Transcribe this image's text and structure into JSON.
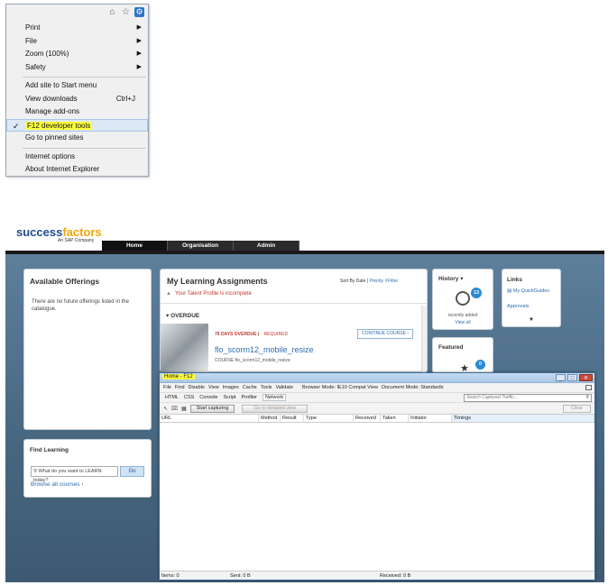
{
  "ie_menu": {
    "toolbar_icons": [
      "home-icon",
      "star-icon",
      "gear-icon"
    ],
    "items": [
      {
        "label": "Print",
        "submenu": true
      },
      {
        "label": "File",
        "submenu": true
      },
      {
        "label": "Zoom (100%)",
        "submenu": true
      },
      {
        "label": "Safety",
        "submenu": true
      },
      {
        "label": "Add site to Start menu"
      },
      {
        "label": "View downloads",
        "shortcut": "Ctrl+J"
      },
      {
        "label": "Manage add-ons"
      },
      {
        "label": "F12 developer tools",
        "selected": true
      },
      {
        "label": "Go to pinned sites"
      },
      {
        "label": "Internet options"
      },
      {
        "label": "About Internet Explorer"
      }
    ],
    "check_mark": "✓"
  },
  "sf": {
    "logo_main": "success",
    "logo_accent": "factors",
    "tagline": "An SAP Company",
    "nav": [
      "Home",
      "Organisation",
      "Admin"
    ],
    "offerings": {
      "title": "Available Offerings",
      "text": "There are no future offerings listed in the catalogue."
    },
    "find": {
      "title": "Find Learning",
      "placeholder": "What do you want to LEARN today?",
      "go": "Go",
      "browse": "Browse all courses"
    },
    "learning": {
      "title": "My Learning Assignments",
      "sort_label": "Sort By Date",
      "sort_priority": "Priority",
      "filter": "Filter",
      "warning": "Your Talent Profile is incomplete",
      "overdue": "OVERDUE",
      "days_overdue": "76 DAYS OVERDUE",
      "required": "REQUIRED",
      "course_title": "flo_scorm12_mobile_resize",
      "course_sub": "COURSE flo_scorm12_mobile_resize",
      "continue": "CONTINUE COURSE"
    },
    "history": {
      "title": "History",
      "badge": "13",
      "label": "recently added",
      "link": "View all"
    },
    "links": {
      "title": "Links",
      "quickguides": "My QuickGuides",
      "approvals": "Approvals"
    },
    "featured": {
      "title": "Featured",
      "badge": "0"
    }
  },
  "f12": {
    "title": "Home - F12",
    "menu": [
      "File",
      "Find",
      "Disable",
      "View",
      "Images",
      "Cache",
      "Tools",
      "Validate"
    ],
    "browser_mode": "Browser Mode: IE10 Compat View",
    "document_mode": "Document Mode: Standards",
    "tabs": [
      "HTML",
      "CSS",
      "Console",
      "Script",
      "Profiler",
      "Network"
    ],
    "active_tab": "Network",
    "search_placeholder": "Search Captured Traffic...",
    "start_capturing": "Start capturing",
    "detailed_view": "Go to detailed view",
    "clear": "Clear",
    "columns": [
      "URL",
      "Method",
      "Result",
      "Type",
      "Received",
      "Taken",
      "Initiator",
      "Timings"
    ],
    "status_items": "Items: 0",
    "status_sent": "Sent: 0 B",
    "status_received": "Received: 0 B"
  },
  "colors": {
    "accent": "#2a8bd1",
    "highlight": "#ffff3a",
    "overdue": "#c0392b"
  }
}
